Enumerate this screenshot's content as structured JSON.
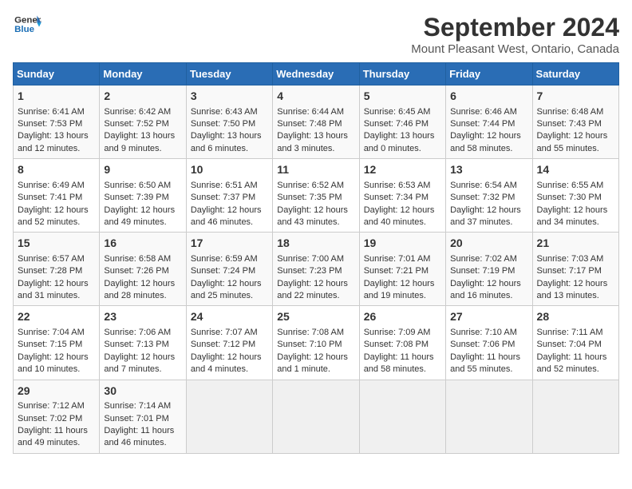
{
  "header": {
    "logo_line1": "General",
    "logo_line2": "Blue",
    "month_title": "September 2024",
    "location": "Mount Pleasant West, Ontario, Canada"
  },
  "days_of_week": [
    "Sunday",
    "Monday",
    "Tuesday",
    "Wednesday",
    "Thursday",
    "Friday",
    "Saturday"
  ],
  "weeks": [
    [
      {
        "day": 1,
        "lines": [
          "Sunrise: 6:41 AM",
          "Sunset: 7:53 PM",
          "Daylight: 13 hours",
          "and 12 minutes."
        ]
      },
      {
        "day": 2,
        "lines": [
          "Sunrise: 6:42 AM",
          "Sunset: 7:52 PM",
          "Daylight: 13 hours",
          "and 9 minutes."
        ]
      },
      {
        "day": 3,
        "lines": [
          "Sunrise: 6:43 AM",
          "Sunset: 7:50 PM",
          "Daylight: 13 hours",
          "and 6 minutes."
        ]
      },
      {
        "day": 4,
        "lines": [
          "Sunrise: 6:44 AM",
          "Sunset: 7:48 PM",
          "Daylight: 13 hours",
          "and 3 minutes."
        ]
      },
      {
        "day": 5,
        "lines": [
          "Sunrise: 6:45 AM",
          "Sunset: 7:46 PM",
          "Daylight: 13 hours",
          "and 0 minutes."
        ]
      },
      {
        "day": 6,
        "lines": [
          "Sunrise: 6:46 AM",
          "Sunset: 7:44 PM",
          "Daylight: 12 hours",
          "and 58 minutes."
        ]
      },
      {
        "day": 7,
        "lines": [
          "Sunrise: 6:48 AM",
          "Sunset: 7:43 PM",
          "Daylight: 12 hours",
          "and 55 minutes."
        ]
      }
    ],
    [
      {
        "day": 8,
        "lines": [
          "Sunrise: 6:49 AM",
          "Sunset: 7:41 PM",
          "Daylight: 12 hours",
          "and 52 minutes."
        ]
      },
      {
        "day": 9,
        "lines": [
          "Sunrise: 6:50 AM",
          "Sunset: 7:39 PM",
          "Daylight: 12 hours",
          "and 49 minutes."
        ]
      },
      {
        "day": 10,
        "lines": [
          "Sunrise: 6:51 AM",
          "Sunset: 7:37 PM",
          "Daylight: 12 hours",
          "and 46 minutes."
        ]
      },
      {
        "day": 11,
        "lines": [
          "Sunrise: 6:52 AM",
          "Sunset: 7:35 PM",
          "Daylight: 12 hours",
          "and 43 minutes."
        ]
      },
      {
        "day": 12,
        "lines": [
          "Sunrise: 6:53 AM",
          "Sunset: 7:34 PM",
          "Daylight: 12 hours",
          "and 40 minutes."
        ]
      },
      {
        "day": 13,
        "lines": [
          "Sunrise: 6:54 AM",
          "Sunset: 7:32 PM",
          "Daylight: 12 hours",
          "and 37 minutes."
        ]
      },
      {
        "day": 14,
        "lines": [
          "Sunrise: 6:55 AM",
          "Sunset: 7:30 PM",
          "Daylight: 12 hours",
          "and 34 minutes."
        ]
      }
    ],
    [
      {
        "day": 15,
        "lines": [
          "Sunrise: 6:57 AM",
          "Sunset: 7:28 PM",
          "Daylight: 12 hours",
          "and 31 minutes."
        ]
      },
      {
        "day": 16,
        "lines": [
          "Sunrise: 6:58 AM",
          "Sunset: 7:26 PM",
          "Daylight: 12 hours",
          "and 28 minutes."
        ]
      },
      {
        "day": 17,
        "lines": [
          "Sunrise: 6:59 AM",
          "Sunset: 7:24 PM",
          "Daylight: 12 hours",
          "and 25 minutes."
        ]
      },
      {
        "day": 18,
        "lines": [
          "Sunrise: 7:00 AM",
          "Sunset: 7:23 PM",
          "Daylight: 12 hours",
          "and 22 minutes."
        ]
      },
      {
        "day": 19,
        "lines": [
          "Sunrise: 7:01 AM",
          "Sunset: 7:21 PM",
          "Daylight: 12 hours",
          "and 19 minutes."
        ]
      },
      {
        "day": 20,
        "lines": [
          "Sunrise: 7:02 AM",
          "Sunset: 7:19 PM",
          "Daylight: 12 hours",
          "and 16 minutes."
        ]
      },
      {
        "day": 21,
        "lines": [
          "Sunrise: 7:03 AM",
          "Sunset: 7:17 PM",
          "Daylight: 12 hours",
          "and 13 minutes."
        ]
      }
    ],
    [
      {
        "day": 22,
        "lines": [
          "Sunrise: 7:04 AM",
          "Sunset: 7:15 PM",
          "Daylight: 12 hours",
          "and 10 minutes."
        ]
      },
      {
        "day": 23,
        "lines": [
          "Sunrise: 7:06 AM",
          "Sunset: 7:13 PM",
          "Daylight: 12 hours",
          "and 7 minutes."
        ]
      },
      {
        "day": 24,
        "lines": [
          "Sunrise: 7:07 AM",
          "Sunset: 7:12 PM",
          "Daylight: 12 hours",
          "and 4 minutes."
        ]
      },
      {
        "day": 25,
        "lines": [
          "Sunrise: 7:08 AM",
          "Sunset: 7:10 PM",
          "Daylight: 12 hours",
          "and 1 minute."
        ]
      },
      {
        "day": 26,
        "lines": [
          "Sunrise: 7:09 AM",
          "Sunset: 7:08 PM",
          "Daylight: 11 hours",
          "and 58 minutes."
        ]
      },
      {
        "day": 27,
        "lines": [
          "Sunrise: 7:10 AM",
          "Sunset: 7:06 PM",
          "Daylight: 11 hours",
          "and 55 minutes."
        ]
      },
      {
        "day": 28,
        "lines": [
          "Sunrise: 7:11 AM",
          "Sunset: 7:04 PM",
          "Daylight: 11 hours",
          "and 52 minutes."
        ]
      }
    ],
    [
      {
        "day": 29,
        "lines": [
          "Sunrise: 7:12 AM",
          "Sunset: 7:02 PM",
          "Daylight: 11 hours",
          "and 49 minutes."
        ]
      },
      {
        "day": 30,
        "lines": [
          "Sunrise: 7:14 AM",
          "Sunset: 7:01 PM",
          "Daylight: 11 hours",
          "and 46 minutes."
        ]
      },
      null,
      null,
      null,
      null,
      null
    ]
  ]
}
